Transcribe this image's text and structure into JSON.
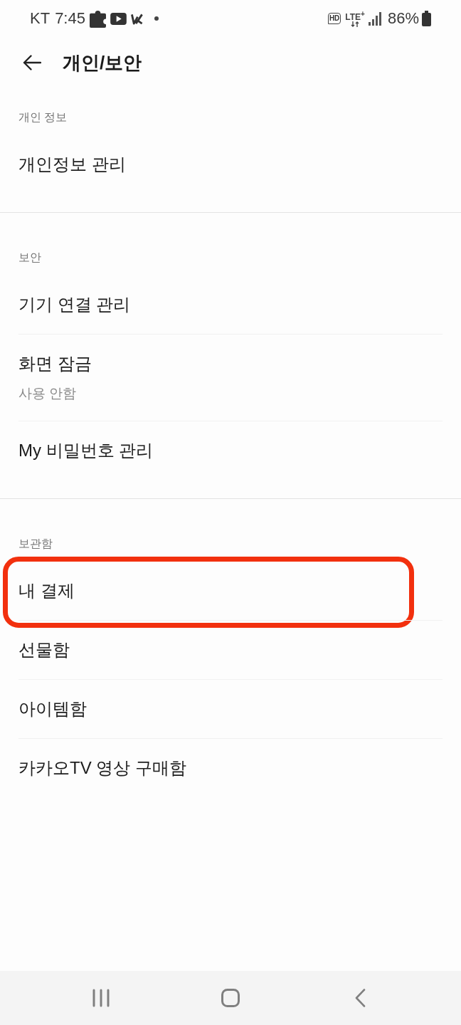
{
  "status_bar": {
    "carrier": "KT",
    "time": "7:45",
    "hd": "HD",
    "network": "LTE$^{+}$",
    "battery": "86%"
  },
  "app_bar": {
    "title": "개인/보안"
  },
  "sections": [
    {
      "header": "개인 정보",
      "items": [
        {
          "title": "개인정보 관리",
          "highlighted": false
        }
      ]
    },
    {
      "header": "보안",
      "items": [
        {
          "title": "기기 연결 관리",
          "highlighted": false
        },
        {
          "title": "화면 잠금",
          "subtitle": "사용 안함",
          "highlighted": false
        },
        {
          "title": "My 비밀번호 관리",
          "highlighted": false
        }
      ]
    },
    {
      "header": "보관함",
      "items": [
        {
          "title": "내 결제",
          "highlighted": true
        },
        {
          "title": "선물함",
          "highlighted": false
        },
        {
          "title": "아이템함",
          "highlighted": false
        },
        {
          "title": "카카오TV 영상 구매함",
          "highlighted": false
        }
      ]
    }
  ]
}
